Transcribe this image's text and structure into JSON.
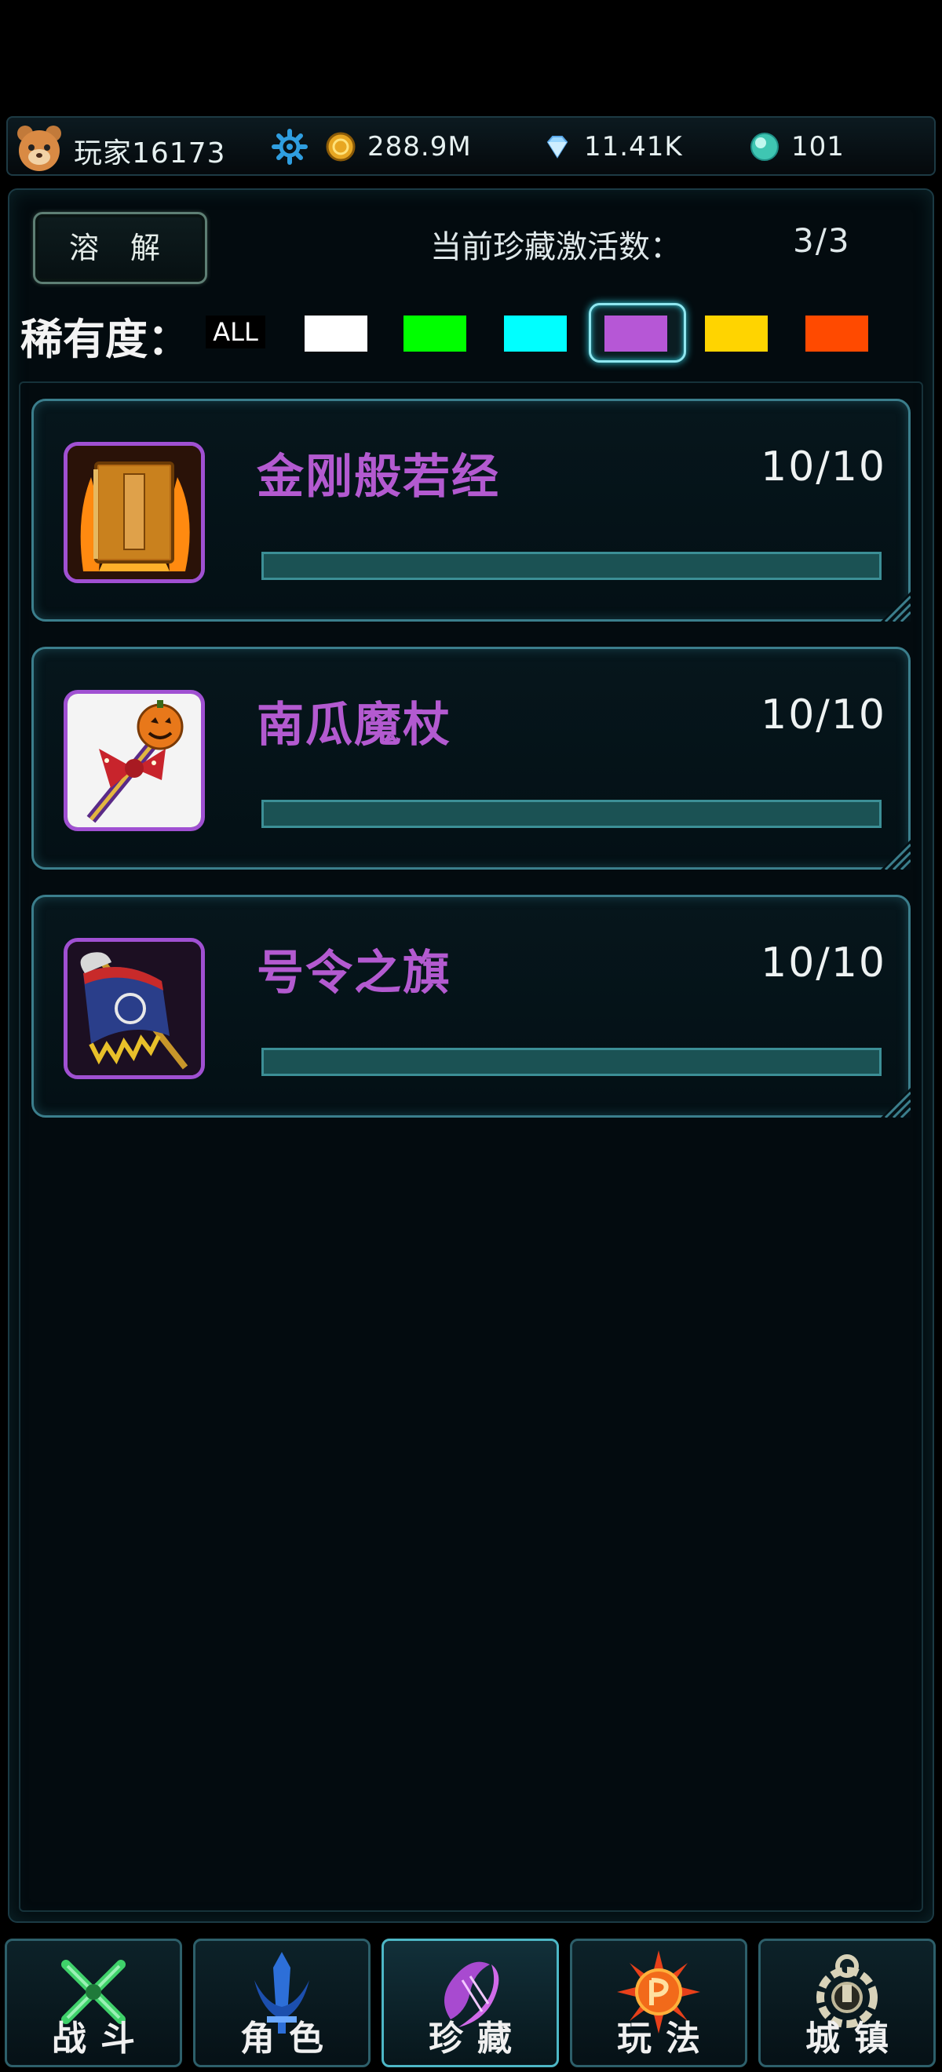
{
  "header": {
    "player_name": "玩家16173",
    "gold": "288.9M",
    "diamonds": "11.41K",
    "crystals": "101"
  },
  "toolbar": {
    "dissolve_label": "溶 解",
    "active_label": "当前珍藏激活数：",
    "active_count": "3/3"
  },
  "filter": {
    "label": "稀有度：",
    "all_label": "ALL",
    "swatches": [
      {
        "id": "white",
        "color": "#ffffff"
      },
      {
        "id": "green",
        "color": "#00ff00"
      },
      {
        "id": "cyan",
        "color": "#00ffff"
      },
      {
        "id": "purple",
        "color": "#b657d6",
        "selected": true
      },
      {
        "id": "yellow",
        "color": "#ffd400"
      },
      {
        "id": "orange",
        "color": "#ff4a00"
      }
    ]
  },
  "collection": [
    {
      "name": "金刚般若经",
      "level": "10/10",
      "progress": 1.0,
      "icon": "sutra-book-icon"
    },
    {
      "name": "南瓜魔杖",
      "level": "10/10",
      "progress": 1.0,
      "icon": "pumpkin-wand-icon"
    },
    {
      "name": "号令之旗",
      "level": "10/10",
      "progress": 1.0,
      "icon": "command-flag-icon"
    }
  ],
  "nav": [
    {
      "label": "战斗",
      "icon": "crossed-swords-icon"
    },
    {
      "label": "角色",
      "icon": "character-sword-icon"
    },
    {
      "label": "珍藏",
      "icon": "collection-lyre-icon",
      "active": true
    },
    {
      "label": "玩法",
      "icon": "gameplay-sun-icon"
    },
    {
      "label": "城镇",
      "icon": "town-emblem-icon"
    }
  ]
}
